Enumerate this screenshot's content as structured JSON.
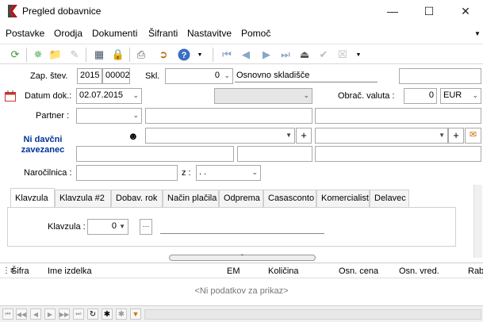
{
  "window": {
    "title": "Pregled dobavnice"
  },
  "menu": [
    "Postavke",
    "Orodja",
    "Dokumenti",
    "Šifranti",
    "Nastavitve",
    "Pomoč"
  ],
  "header": {
    "zap_label": "Zap. štev.",
    "zap_year": "2015",
    "zap_number": "00002",
    "skl_label": "Skl.",
    "skl_value": "0",
    "skl_name": "Osnovno skladišče"
  },
  "form": {
    "datum_label": "Datum dok.:",
    "datum_value": "02.07.2015",
    "valuta_label": "Obrač. valuta :",
    "valuta_rate": "0",
    "valuta_code": "EUR",
    "partner_label": "Partner :",
    "tax_status": "Ni davčni zavezanec",
    "narocilnica_label": "Naročilnica :",
    "z_label": "z :",
    "z_value": ". ."
  },
  "tabs": [
    "Klavzula",
    "Klavzula #2",
    "Dobav. rok",
    "Način plačila",
    "Odprema",
    "Casasconto",
    "Komercialist",
    "Delavec"
  ],
  "tab_panel": {
    "klavzula_label": "Klavzula :",
    "klavzula_value": "0"
  },
  "grid": {
    "columns": [
      "Šifra",
      "Ime izdelka",
      "EM",
      "Količina",
      "Osn. cena",
      "Osn. vred.",
      "Rab"
    ],
    "empty_text": "<Ni podatkov za prikaz>"
  },
  "colors": {
    "accent": "#003399",
    "border": "#a9a9a9"
  }
}
